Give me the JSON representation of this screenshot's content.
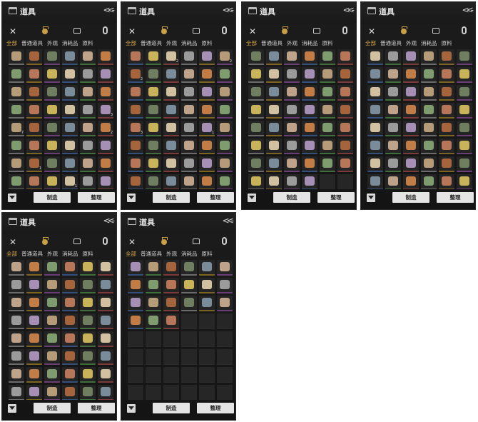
{
  "window": {
    "title": "道具",
    "tabs": [
      "全部",
      "普通道具",
      "外观",
      "消耗品",
      "原料"
    ],
    "active_tab": "全部",
    "buttons": {
      "make": "制造",
      "sort": "整理"
    }
  },
  "panels": [
    {
      "rows": 8,
      "filled": 48,
      "quantities": [
        "",
        "",
        "",
        "",
        "",
        "",
        "",
        "",
        "",
        "",
        "",
        "",
        "",
        "",
        "",
        "",
        "",
        "",
        "",
        "",
        "",
        "",
        "",
        "3",
        "7",
        "",
        "",
        "",
        "",
        "2",
        "",
        "",
        "",
        "",
        "",
        "",
        "",
        "1",
        "",
        "",
        "",
        "",
        "",
        "",
        "",
        "1",
        "",
        "",
        "1"
      ]
    },
    {
      "rows": 8,
      "filled": 48,
      "quantities": [
        "",
        "",
        "2",
        "",
        "",
        "2",
        "2",
        "",
        "",
        "",
        "",
        "",
        "",
        "",
        "",
        "",
        "",
        "",
        "",
        "",
        "",
        "",
        "",
        "",
        "3",
        "",
        "",
        "",
        "1",
        "",
        "",
        "",
        "",
        "",
        "",
        "",
        "",
        "",
        "",
        "",
        "",
        "",
        "",
        "",
        "",
        "",
        "",
        "",
        ""
      ]
    },
    {
      "rows": 8,
      "filled": 46,
      "quantities": [
        "",
        "",
        "",
        "",
        "",
        "",
        "",
        "",
        "",
        "",
        "",
        "",
        "",
        "",
        "",
        "",
        "",
        "",
        "",
        "",
        "",
        "",
        "",
        "",
        "",
        "",
        "",
        "",
        "",
        "",
        "",
        "",
        "",
        "",
        "",
        "",
        "",
        "",
        "",
        "",
        "",
        "",
        "",
        "",
        "",
        ""
      ]
    },
    {
      "rows": 8,
      "filled": 48,
      "quantities": [
        "",
        "",
        "",
        "",
        "",
        "",
        "",
        "",
        "",
        "",
        "",
        "",
        "",
        "",
        "",
        "",
        "",
        "",
        "",
        "",
        "",
        "",
        "",
        "",
        "",
        "",
        "",
        "",
        "",
        "",
        "",
        "",
        "",
        "",
        "",
        "",
        "",
        "",
        "",
        "",
        "",
        "",
        "",
        "",
        "",
        "",
        "",
        ""
      ]
    },
    {
      "rows": 8,
      "filled": 48,
      "quantities": [
        "",
        "",
        "",
        "",
        "",
        "",
        "",
        "",
        "",
        "",
        "",
        "",
        "",
        "",
        "",
        "",
        "",
        "",
        "",
        "",
        "",
        "",
        "",
        "",
        "",
        "",
        "",
        "",
        "",
        "",
        "",
        "",
        "",
        "",
        "",
        "",
        "",
        "",
        "",
        "",
        "",
        "",
        "",
        "",
        "",
        "",
        "",
        ""
      ]
    },
    {
      "rows": 8,
      "filled": 21,
      "quantities": [
        "",
        "",
        "",
        "",
        "",
        "",
        "",
        "",
        "",
        "",
        "",
        "",
        "",
        "",
        "",
        "",
        "",
        "",
        "",
        "",
        ""
      ]
    }
  ],
  "colors": {
    "panel_bg": "#1a1a1a",
    "tab_active": "#d8a84a",
    "button_bg": "#e4e4e4"
  }
}
